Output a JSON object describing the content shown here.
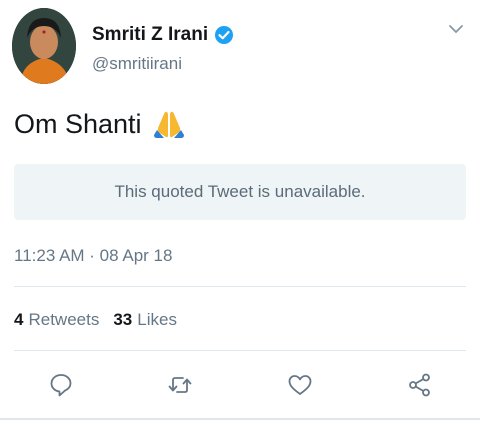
{
  "author": {
    "display_name": "Smriti Z Irani",
    "handle": "@smritiirani",
    "verified": true,
    "avatar_icon": "profile-avatar"
  },
  "tweet": {
    "text": "Om Shanti",
    "emoji_icon": "folded-hands-icon",
    "quoted_notice": "This quoted Tweet is unavailable.",
    "timestamp": "11:23 AM · 08 Apr 18"
  },
  "stats": {
    "retweets_count": "4",
    "retweets_label": "Retweets",
    "likes_count": "33",
    "likes_label": "Likes"
  },
  "actions": [
    "reply-icon",
    "retweet-icon",
    "like-icon",
    "share-icon"
  ],
  "colors": {
    "verified_blue": "#1da1f2",
    "secondary_text": "#657786",
    "quote_background": "#eff4f7",
    "divider": "#e1e8ed"
  }
}
